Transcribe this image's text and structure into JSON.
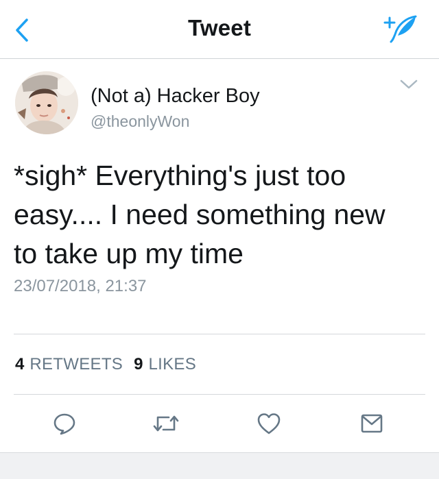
{
  "nav": {
    "title": "Tweet",
    "back_icon": "chevron-left-icon",
    "compose_icon": "compose-tweet-icon",
    "accent_color": "#1da1f2"
  },
  "tweet": {
    "display_name": "(Not a) Hacker Boy",
    "handle": "@theonlyWon",
    "text_lines": [
      "*sigh* Everything's just too",
      "easy.... I need something new",
      "to take up my time"
    ],
    "timestamp": "23/07/2018, 21:37",
    "stats": {
      "retweets_count": "4",
      "retweets_label": "RETWEETS",
      "likes_count": "9",
      "likes_label": "LIKES"
    },
    "actions": [
      "reply-icon",
      "retweet-icon",
      "like-icon",
      "share-message-icon"
    ]
  }
}
